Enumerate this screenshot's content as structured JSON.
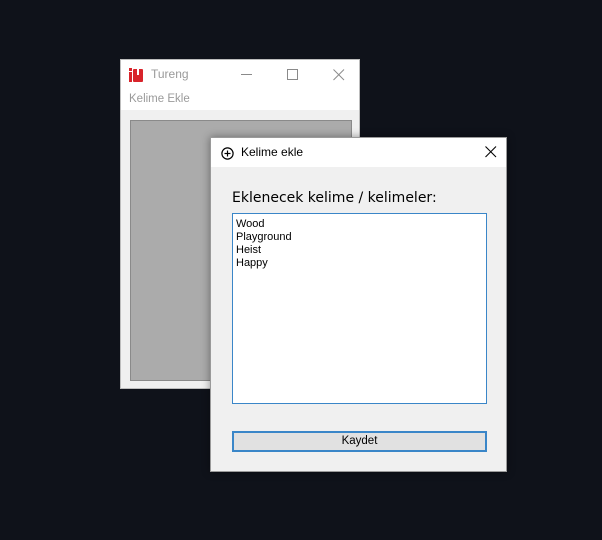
{
  "main_window": {
    "title": "Tureng",
    "menu": [
      "Kelime Ekle"
    ],
    "icon": "tureng-logo-icon",
    "accent": "#d8232a"
  },
  "dialog": {
    "title": "Kelime ekle",
    "icon": "plus-circle-icon",
    "prompt": "Eklenecek kelime / kelimeler:",
    "words": [
      "Wood",
      "Playground",
      "Heist",
      "Happy"
    ],
    "save_label": "Kaydet",
    "focus_color": "#3a86c8"
  }
}
